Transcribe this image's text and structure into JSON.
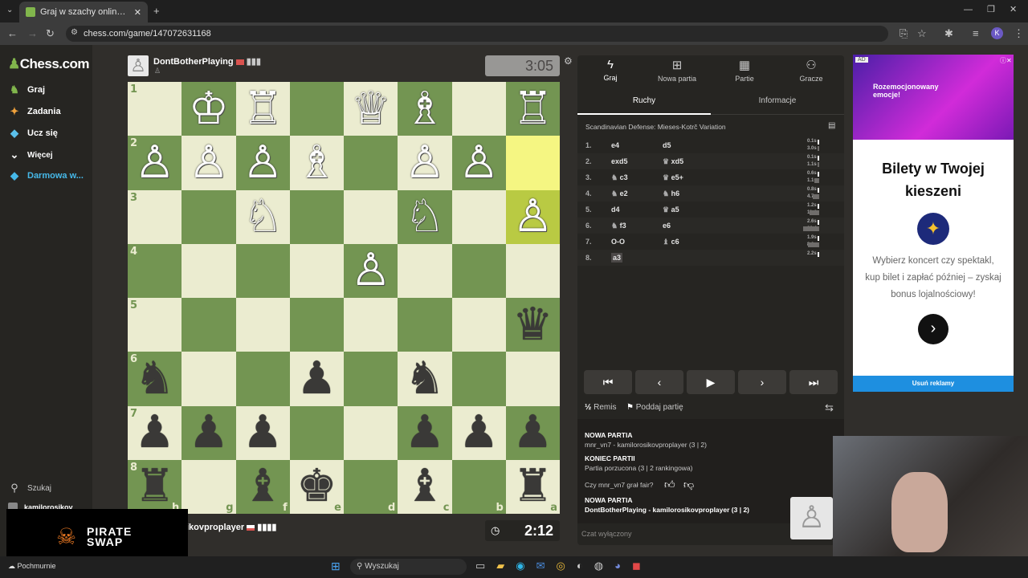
{
  "browser": {
    "tab_title": "Graj w szachy online ZA DARMO",
    "url": "chess.com/game/147072631168",
    "profile_initial": "K"
  },
  "sidebar": {
    "logo": "Chess.com",
    "items": [
      {
        "label": "Graj",
        "icon": "play-icon"
      },
      {
        "label": "Zadania",
        "icon": "puzzle-icon"
      },
      {
        "label": "Ucz się",
        "icon": "learn-icon"
      },
      {
        "label": "Więcej",
        "icon": "chevron-down-icon"
      },
      {
        "label": "Darmowa w...",
        "icon": "diamond-icon"
      }
    ],
    "search": "Szukaj",
    "user": "kamilorosikov",
    "status": "Pochmurnie"
  },
  "top_player": {
    "name": "DontBotherPlaying",
    "clock": "3:05"
  },
  "bottom_player": {
    "name": "kamilorosikovproplayer",
    "name_visible": "ikovproplayer",
    "clock": "2:12"
  },
  "board": {
    "squares": [
      [
        "",
        "♔",
        "♖",
        "",
        "♕",
        "♗",
        "",
        "♖"
      ],
      [
        "♙",
        "♙",
        "♙",
        "♗",
        "",
        "♙",
        "♙",
        ""
      ],
      [
        "",
        "",
        "♘",
        "",
        "",
        "♘",
        "",
        "♙"
      ],
      [
        "",
        "",
        "",
        "",
        "♙",
        "",
        "",
        ""
      ],
      [
        "",
        "",
        "",
        "",
        "",
        "",
        "",
        "♛"
      ],
      [
        "♞",
        "",
        "",
        "♟",
        "",
        "♞",
        "",
        ""
      ],
      [
        "♟",
        "♟",
        "♟",
        "",
        "",
        "♟",
        "♟",
        "♟"
      ],
      [
        "♜",
        "",
        "♝",
        "♚",
        "",
        "♝",
        "",
        "♜"
      ]
    ],
    "ranks": [
      "1",
      "2",
      "3",
      "4",
      "5",
      "6",
      "7",
      "8"
    ],
    "files": [
      "h",
      "g",
      "f",
      "e",
      "d",
      "c",
      "b",
      "a"
    ]
  },
  "panel": {
    "tabs": [
      {
        "label": "Graj",
        "icon": "bolt-icon"
      },
      {
        "label": "Nowa partia",
        "icon": "plus-icon"
      },
      {
        "label": "Partie",
        "icon": "board-icon"
      },
      {
        "label": "Gracze",
        "icon": "players-icon"
      }
    ],
    "subtabs": [
      "Ruchy",
      "Informacje"
    ],
    "opening": "Scandinavian Defense: Mieses-Kotrč Variation",
    "moves": [
      {
        "n": "1.",
        "w": "e4",
        "b": "d5",
        "tw": "0.1s",
        "tb": "3.0s"
      },
      {
        "n": "2.",
        "w": "exd5",
        "b": "xd5",
        "tw": "0.1s",
        "tb": "1.1s"
      },
      {
        "n": "3.",
        "w": "c3",
        "b": "e5+",
        "tw": "0.6s",
        "tb": "1.1s"
      },
      {
        "n": "4.",
        "w": "e2",
        "b": "h6",
        "tw": "0.8s",
        "tb": "4.7s"
      },
      {
        "n": "5.",
        "w": "d4",
        "b": "a5",
        "tw": "1.2s",
        "tb": "11.4s"
      },
      {
        "n": "6.",
        "w": "f3",
        "b": "e6",
        "tw": "2.6s",
        "tb": "22.4s"
      },
      {
        "n": "7.",
        "w": "O-O",
        "b": "c6",
        "tw": "1.9s",
        "tb": "8.8s"
      },
      {
        "n": "8.",
        "w": "a3",
        "b": "",
        "tw": "2.2s",
        "tb": ""
      }
    ],
    "remis": "Remis",
    "resign": "Poddaj partię",
    "log": [
      {
        "title": "NOWA PARTIA",
        "text": "mnr_vn7 - kamilorosikovproplayer (3 | 2)"
      },
      {
        "title": "KONIEC PARTII",
        "text": "Partia porzucona (3 | 2 rankingowa)"
      }
    ],
    "fair_question": "Czy mnr_vn7 grał fair?",
    "log2": {
      "title": "NOWA PARTIA",
      "text": "DontBotherPlaying - kamilorosikovproplayer (3 | 2)"
    },
    "chat": "Czat wyłączony"
  },
  "ad": {
    "badge": "AD",
    "img_text": "Rozemocjonowany emocje!",
    "headline": "Bilety w Twojej kieszeni",
    "body": "Wybierz koncert czy spektakl, kup bilet i zapłać później – zyskaj bonus lojalnościowy!",
    "remove": "Usuń reklamy"
  },
  "overlay": {
    "brand": "PIRATE SWAP"
  },
  "taskbar": {
    "search": "Wyszukaj"
  }
}
